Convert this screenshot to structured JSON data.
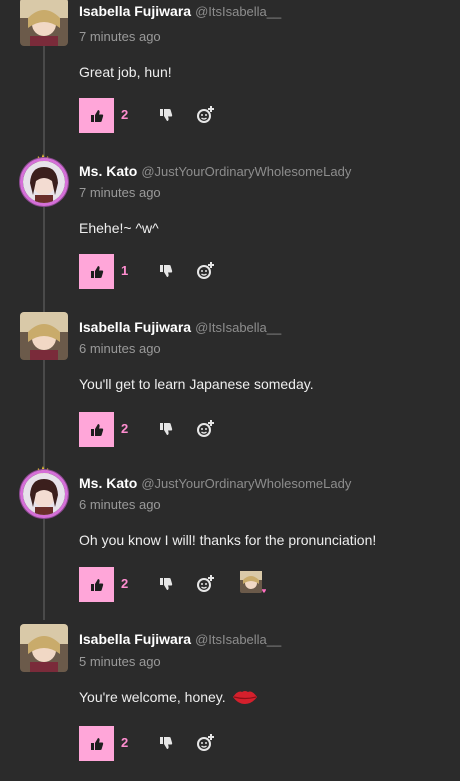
{
  "comments": [
    {
      "author": "Isabella Fujiwara",
      "handle": "@ItsIsabella__",
      "time": "7 minutes ago",
      "text": "Great job, hun!",
      "likes": "2",
      "avatar": "isabella",
      "has_reaction": false,
      "has_emoji": false
    },
    {
      "author": "Ms. Kato",
      "handle": "@JustYourOrdinaryWholesomeLady",
      "time": "7 minutes ago",
      "text": "Ehehe!~ ^w^",
      "likes": "1",
      "avatar": "kato",
      "has_reaction": false,
      "has_emoji": false
    },
    {
      "author": "Isabella Fujiwara",
      "handle": "@ItsIsabella__",
      "time": "6 minutes ago",
      "text": "You'll get to learn Japanese someday.",
      "likes": "2",
      "avatar": "isabella",
      "has_reaction": false,
      "has_emoji": false
    },
    {
      "author": "Ms. Kato",
      "handle": "@JustYourOrdinaryWholesomeLady",
      "time": "6 minutes ago",
      "text": "Oh you know I will! thanks for the pronunciation!",
      "likes": "2",
      "avatar": "kato",
      "has_reaction": true,
      "has_emoji": false
    },
    {
      "author": "Isabella Fujiwara",
      "handle": "@ItsIsabella__",
      "time": "5 minutes ago",
      "text": "You're welcome, honey.",
      "likes": "2",
      "avatar": "isabella",
      "has_reaction": false,
      "has_emoji": true
    }
  ],
  "icons": {
    "like": "thumbs-up-icon",
    "dislike": "thumbs-down-icon",
    "react": "add-reaction-icon",
    "emoji": "kiss-lips-icon"
  },
  "colors": {
    "background": "#2b2b2b",
    "like_button": "#ffa6d9",
    "like_count": "#ff8ed0",
    "avatar_ring": "#d56fd8"
  }
}
